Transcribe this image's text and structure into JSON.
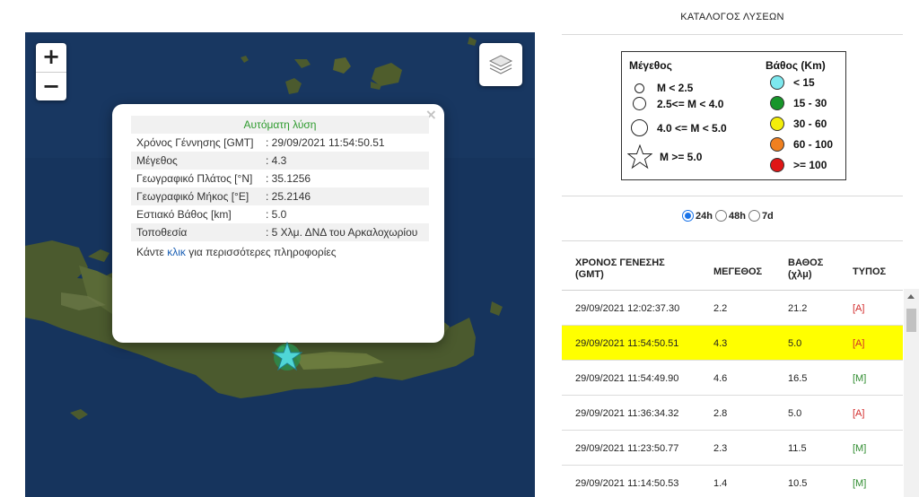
{
  "map": {
    "zoom_in": "+",
    "zoom_out": "−",
    "popup": {
      "title": "Αυτόματη λύση",
      "close": "×",
      "rows": [
        {
          "label": "Χρόνος Γέννησης [GMT]",
          "value": ": 29/09/2021 11:54:50.51"
        },
        {
          "label": "Μέγεθος",
          "value": ": 4.3"
        },
        {
          "label": "Γεωγραφικό Πλάτος [°N]",
          "value": ": 35.1256"
        },
        {
          "label": "Γεωγραφικό Μήκος [°E]",
          "value": ": 25.2146"
        },
        {
          "label": "Εστιακό Βάθος [km]",
          "value": ": 5.0"
        },
        {
          "label": "Τοποθεσία",
          "value": ": 5 Χλμ. ΔΝΔ του Αρκαλοχωρίου"
        }
      ],
      "footer_before": "Κάντε ",
      "footer_link": "κλικ",
      "footer_after": " για περισσότερες πληροφορίες"
    },
    "colors": {
      "sea": "#16345d",
      "land": "#4b5a2e",
      "star": "#4fd6d6"
    }
  },
  "panel": {
    "title": "ΚΑΤΑΛΟΓΟΣ ΛΥΣΕΩΝ",
    "legend": {
      "magnitude_title": "Μέγεθος",
      "depth_title": "Βάθος (Km)",
      "magnitudes": [
        "M < 2.5",
        "2.5<= M < 4.0",
        "4.0 <= M < 5.0",
        "M >= 5.0"
      ],
      "depths": [
        {
          "label": "< 15",
          "color": "#7de8ee"
        },
        {
          "label": "15 - 30",
          "color": "#17962a"
        },
        {
          "label": "30 - 60",
          "color": "#f3ee0a"
        },
        {
          "label": "60 - 100",
          "color": "#f08020"
        },
        {
          "label": ">= 100",
          "color": "#e01616"
        }
      ]
    },
    "periods": [
      {
        "label": "24h",
        "selected": true
      },
      {
        "label": "48h",
        "selected": false
      },
      {
        "label": "7d",
        "selected": false
      }
    ],
    "table": {
      "headers": {
        "time_1": "ΧΡΟΝΟΣ ΓΕΝΕΣΗΣ",
        "time_2": "(GMT)",
        "magnitude": "ΜΕΓΕΘΟΣ",
        "depth_1": "ΒΑΘΟΣ",
        "depth_2": "(χλμ)",
        "type": "ΤΥΠΟΣ"
      },
      "rows": [
        {
          "time": "29/09/2021 12:02:37.30",
          "mag": "2.2",
          "depth": "21.2",
          "type": "[A]",
          "highlight": false
        },
        {
          "time": "29/09/2021 11:54:50.51",
          "mag": "4.3",
          "depth": "5.0",
          "type": "[A]",
          "highlight": true
        },
        {
          "time": "29/09/2021 11:54:49.90",
          "mag": "4.6",
          "depth": "16.5",
          "type": "[M]",
          "highlight": false
        },
        {
          "time": "29/09/2021 11:36:34.32",
          "mag": "2.8",
          "depth": "5.0",
          "type": "[A]",
          "highlight": false
        },
        {
          "time": "29/09/2021 11:23:50.77",
          "mag": "2.3",
          "depth": "11.5",
          "type": "[M]",
          "highlight": false
        },
        {
          "time": "29/09/2021 11:14:50.53",
          "mag": "1.4",
          "depth": "10.5",
          "type": "[M]",
          "highlight": false
        }
      ]
    }
  }
}
